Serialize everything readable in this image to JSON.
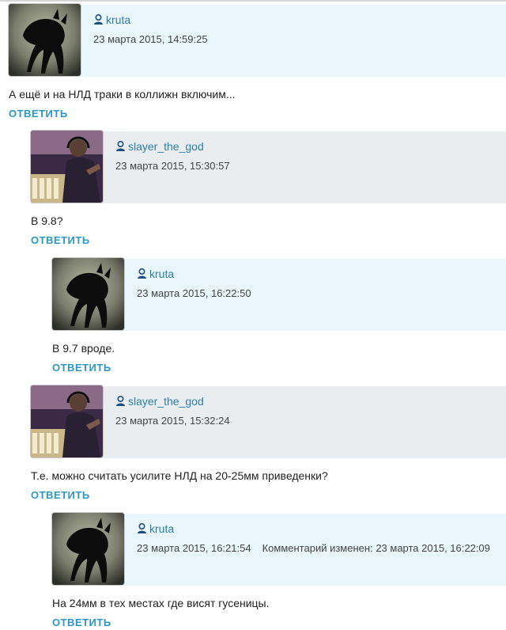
{
  "comments": [
    {
      "username": "kruta",
      "date": "23 марта 2015, 14:59:25",
      "text": "А ещё и на НЛД траки в коллижн включим...",
      "reply": "ОТВЕТИТЬ",
      "avatar": "black-cat-avatar"
    },
    {
      "username": "slayer_the_god",
      "date": "23 марта 2015, 15:30:57",
      "text": "В 9.8?",
      "reply": "ОТВЕТИТЬ",
      "avatar": "dj-studio-avatar"
    },
    {
      "username": "kruta",
      "date": "23 марта 2015, 16:22:50",
      "text": "В 9.7 вроде.",
      "reply": "ОТВЕТИТЬ",
      "avatar": "black-cat-avatar"
    },
    {
      "username": "slayer_the_god",
      "date": "23 марта 2015, 15:32:24",
      "text": "Т.е. можно считать усилите НЛД на 20-25мм приведенки?",
      "reply": "ОТВЕТИТЬ",
      "avatar": "dj-studio-avatar"
    },
    {
      "username": "kruta",
      "date": "23 марта 2015, 16:21:54",
      "edited_label": "Комментарий изменен:",
      "edited_date": "23 марта 2015, 16:22:09",
      "text": "На 24мм в тех местах где висят гусеницы.",
      "reply": "ОТВЕТИТЬ",
      "avatar": "black-cat-avatar"
    }
  ],
  "colors": {
    "username": "#2f7ea8",
    "reply_link": "#2c98c8",
    "header_bg": "#e9f6fb",
    "header_bg_alt": "#e9edf0"
  }
}
